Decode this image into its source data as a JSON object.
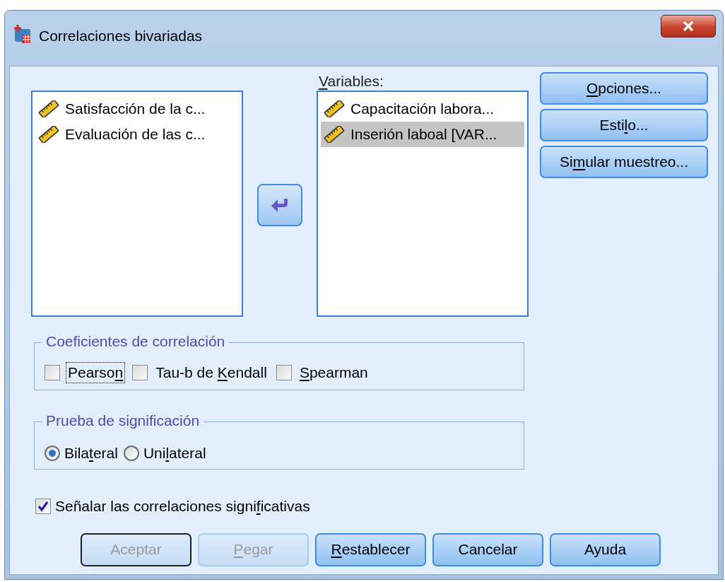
{
  "window": {
    "title": "Correlaciones bivariadas"
  },
  "source_list": {
    "items": [
      {
        "text": "Satisfacción de la c...",
        "selected": false
      },
      {
        "text": "Evaluación de las c...",
        "selected": false
      }
    ]
  },
  "variables": {
    "label": [
      {
        "text": "V",
        "underlined": true
      },
      {
        "text": "ariables:",
        "underlined": false
      }
    ],
    "items": [
      {
        "text": "Capacitación labora...",
        "selected": false
      },
      {
        "text": "Inserión laboal [VAR...",
        "selected": true
      }
    ]
  },
  "side_buttons": [
    {
      "label": [
        {
          "text": "O",
          "underlined": true
        },
        {
          "text": "pciones...",
          "underlined": false
        }
      ]
    },
    {
      "label": [
        {
          "text": "Esti",
          "underlined": false
        },
        {
          "text": "l",
          "underlined": true
        },
        {
          "text": "o...",
          "underlined": false
        }
      ]
    },
    {
      "label": [
        {
          "text": "Si",
          "underlined": false
        },
        {
          "text": "m",
          "underlined": true
        },
        {
          "text": "ular muestreo...",
          "underlined": false
        }
      ]
    }
  ],
  "coefficients": {
    "title": "Coeficientes de correlación",
    "options": [
      {
        "label": [
          {
            "text": "Pearso",
            "underlined": false
          },
          {
            "text": "n",
            "underlined": true
          }
        ],
        "checked": false,
        "focused": true
      },
      {
        "label": [
          {
            "text": "Tau-b de ",
            "underlined": false
          },
          {
            "text": "K",
            "underlined": true
          },
          {
            "text": "endall",
            "underlined": false
          }
        ],
        "checked": false,
        "focused": false
      },
      {
        "label": [
          {
            "text": "S",
            "underlined": true
          },
          {
            "text": "pearman",
            "underlined": false
          }
        ],
        "checked": false,
        "focused": false
      }
    ]
  },
  "significance": {
    "title": "Prueba de significación",
    "options": [
      {
        "label": [
          {
            "text": "Bila",
            "underlined": false
          },
          {
            "text": "t",
            "underlined": true
          },
          {
            "text": "eral",
            "underlined": false
          }
        ],
        "selected": true
      },
      {
        "label": [
          {
            "text": "Uni",
            "underlined": false
          },
          {
            "text": "l",
            "underlined": true
          },
          {
            "text": "ateral",
            "underlined": false
          }
        ],
        "selected": false
      }
    ]
  },
  "flag_significant": {
    "label": [
      {
        "text": "Señalar las correlaciones signi",
        "underlined": false
      },
      {
        "text": "f",
        "underlined": true
      },
      {
        "text": "icativas",
        "underlined": false
      }
    ],
    "checked": true
  },
  "buttons": [
    {
      "label": [
        {
          "text": "Aceptar",
          "underlined": false
        }
      ],
      "disabled": true,
      "default": true
    },
    {
      "label": [
        {
          "text": "P",
          "underlined": true
        },
        {
          "text": "egar",
          "underlined": false
        }
      ],
      "disabled": true,
      "default": false
    },
    {
      "label": [
        {
          "text": "R",
          "underlined": true
        },
        {
          "text": "establecer",
          "underlined": false
        }
      ],
      "disabled": false,
      "default": false
    },
    {
      "label": [
        {
          "text": "Cancelar",
          "underlined": false
        }
      ],
      "disabled": false,
      "default": false
    },
    {
      "label": [
        {
          "text": "Ayuda",
          "underlined": false
        }
      ],
      "disabled": false,
      "default": false
    }
  ]
}
